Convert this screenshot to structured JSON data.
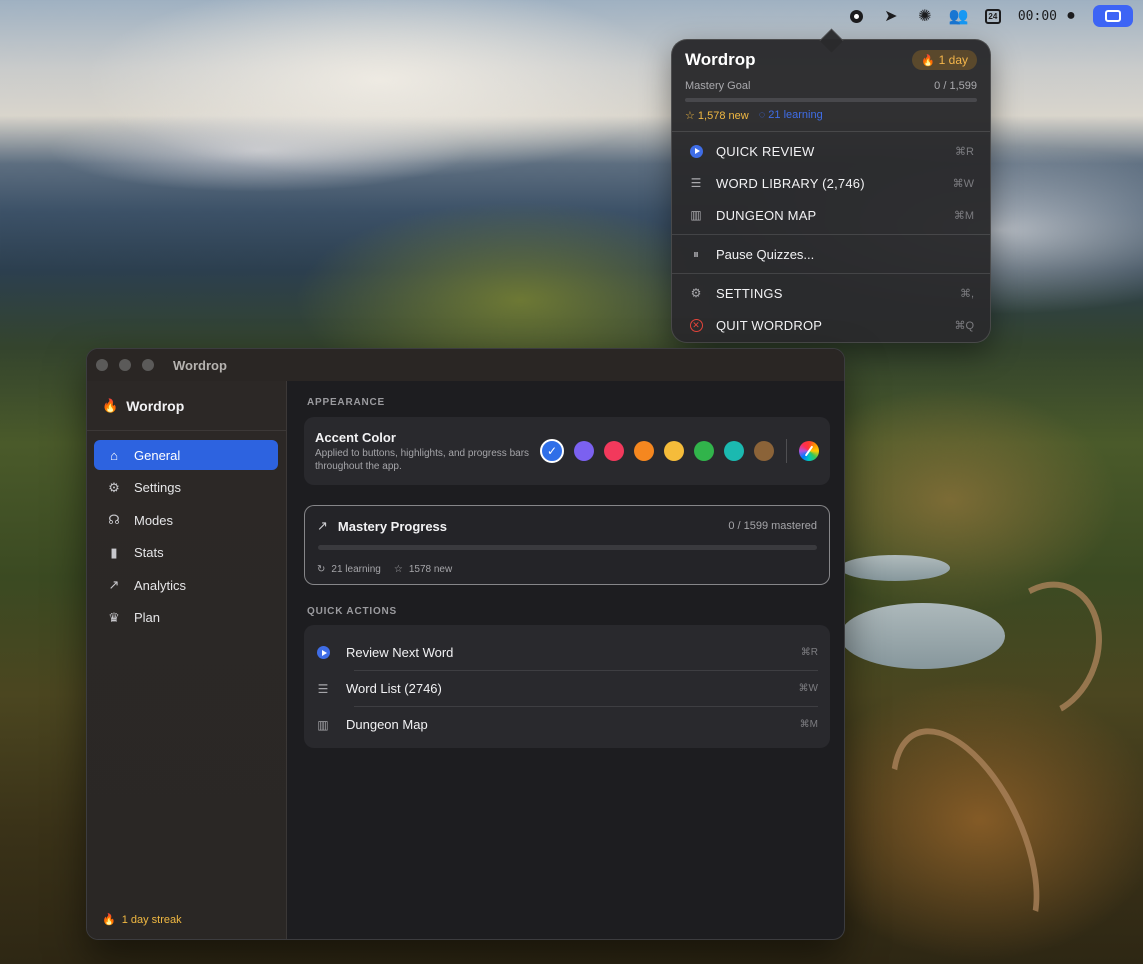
{
  "menubar": {
    "icons": [
      "wordrop-drop-icon",
      "send-icon",
      "asterisk-icon",
      "people-icon",
      "calendar-icon"
    ],
    "calendar_day": "24",
    "clock": "00:00"
  },
  "popover": {
    "title": "Wordrop",
    "streak_badge": "1 day",
    "goal_label": "Mastery Goal",
    "goal_value": "0 / 1,599",
    "new_count": "☆ 1,578 new",
    "learning_count": "◌ 21 learning",
    "items": [
      {
        "label": "QUICK REVIEW",
        "shortcut": "⌘R"
      },
      {
        "label": "WORD LIBRARY (2,746)",
        "shortcut": "⌘W"
      },
      {
        "label": "DUNGEON MAP",
        "shortcut": "⌘M"
      }
    ],
    "pause_label": "Pause Quizzes...",
    "settings": {
      "label": "SETTINGS",
      "shortcut": "⌘,"
    },
    "quit": {
      "label": "QUIT WORDROP",
      "shortcut": "⌘Q"
    }
  },
  "window": {
    "title": "Wordrop",
    "sidebar": {
      "brand": "Wordrop",
      "items": [
        {
          "label": "General",
          "icon": "house-icon"
        },
        {
          "label": "Settings",
          "icon": "gear-icon"
        },
        {
          "label": "Modes",
          "icon": "brain-icon"
        },
        {
          "label": "Stats",
          "icon": "bar-chart-icon"
        },
        {
          "label": "Analytics",
          "icon": "line-chart-icon"
        },
        {
          "label": "Plan",
          "icon": "crown-icon"
        }
      ],
      "streak": "1 day streak"
    },
    "appearance": {
      "section_label": "APPEARANCE",
      "accent_title": "Accent Color",
      "accent_desc": "Applied to buttons, highlights, and progress bars throughout the app.",
      "swatches": [
        "#2f6fe8",
        "#7b61f0",
        "#f2395c",
        "#f5871f",
        "#f5bc3a",
        "#31b44b",
        "#1bb9b0",
        "#8b6338"
      ]
    },
    "mastery": {
      "title": "Mastery Progress",
      "count": "0 / 1599 mastered",
      "learning": "21 learning",
      "new": "1578 new"
    },
    "quick_actions": {
      "section_label": "QUICK ACTIONS",
      "items": [
        {
          "label": "Review Next Word",
          "shortcut": "⌘R"
        },
        {
          "label": "Word List (2746)",
          "shortcut": "⌘W"
        },
        {
          "label": "Dungeon Map",
          "shortcut": "⌘M"
        }
      ]
    }
  }
}
